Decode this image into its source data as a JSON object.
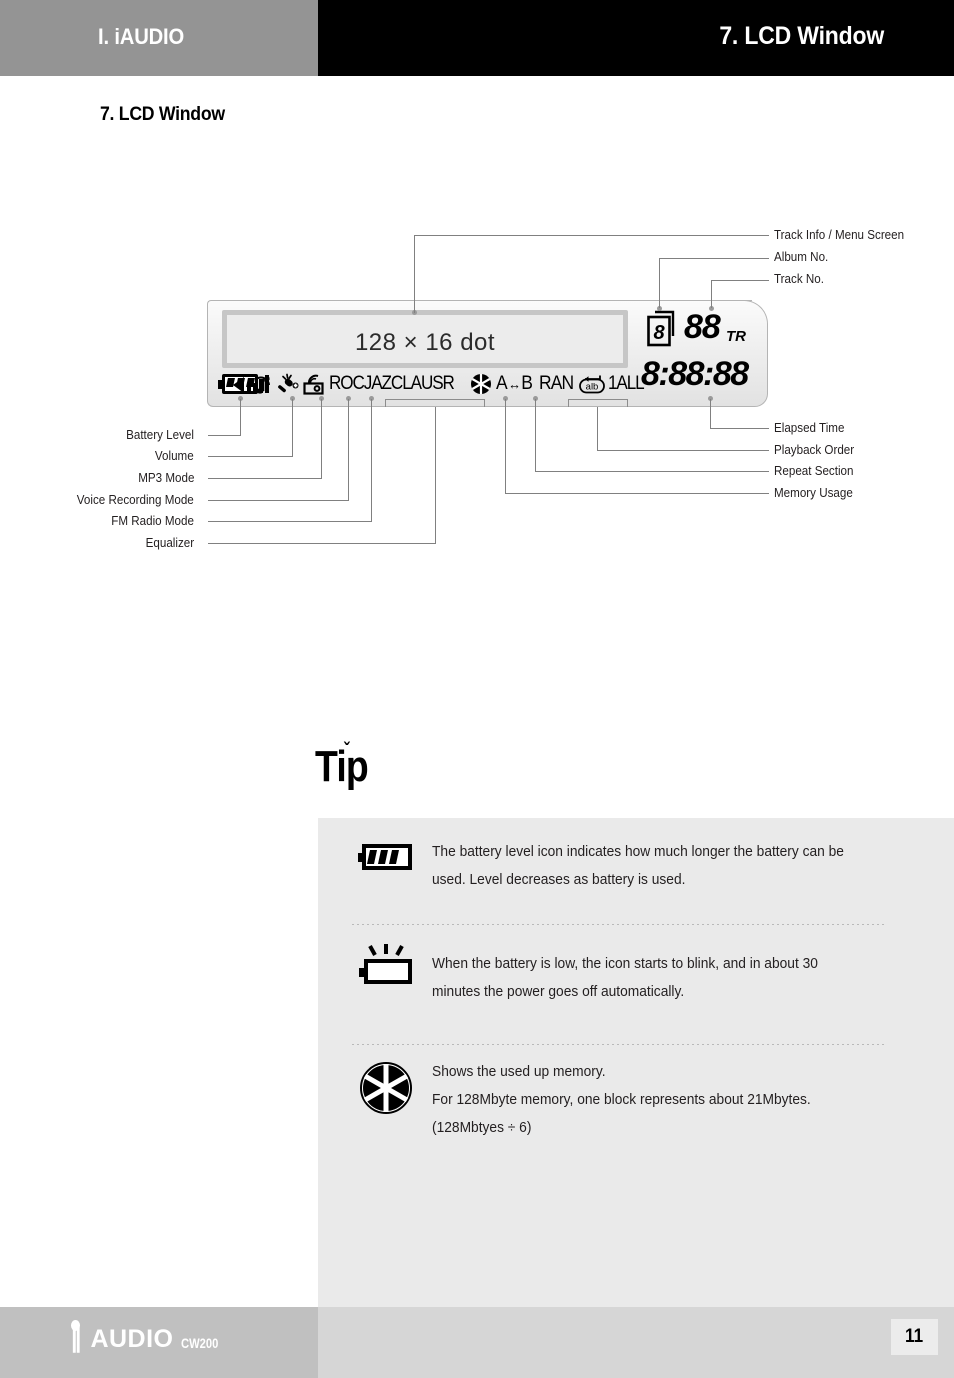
{
  "header": {
    "left_title": "I. iAUDIO",
    "right_title": "7. LCD Window"
  },
  "section": {
    "title": "7. LCD Window"
  },
  "lcd": {
    "screen_text": "128 × 16 dot",
    "equalizer_presets": "ROCJAZCLAUSR",
    "ab_repeat": "A",
    "ab_repeat_b": "B",
    "random": "RAN",
    "album_repeat_label": "alb",
    "one_all": "1ALL",
    "album_digit": "8",
    "track_number": "88",
    "track_unit": "TR",
    "elapsed_time": "8:88:88"
  },
  "callouts_left": [
    {
      "label": "Battery Level"
    },
    {
      "label": "Volume"
    },
    {
      "label": "MP3 Mode"
    },
    {
      "label": "Voice Recording Mode"
    },
    {
      "label": "FM Radio Mode"
    },
    {
      "label": "Equalizer"
    }
  ],
  "callouts_right_top": [
    {
      "label": "Track Info / Menu Screen"
    },
    {
      "label": "Album No."
    },
    {
      "label": "Track No."
    }
  ],
  "callouts_right_bottom": [
    {
      "label": "Elapsed Time"
    },
    {
      "label": "Playback Order"
    },
    {
      "label": "Repeat Section"
    },
    {
      "label": "Memory Usage"
    }
  ],
  "tip": {
    "title": "Tip",
    "items": [
      {
        "icon": "battery-full-icon",
        "lines": [
          "The battery level icon indicates how much longer the battery can be",
          "used. Level decreases as battery is used."
        ]
      },
      {
        "icon": "battery-low-blink-icon",
        "lines": [
          "When the battery is low, the icon starts to blink, and in about 30",
          "minutes the power goes off automatically."
        ]
      },
      {
        "icon": "memory-usage-icon",
        "lines": [
          "Shows the used up memory.",
          "For 128Mbyte memory, one block represents about 21Mbytes.",
          " (128Mbtyes ÷ 6)"
        ]
      }
    ]
  },
  "footer": {
    "brand": "AUDIO",
    "model": "CW200",
    "page": "11"
  },
  "colors": {
    "header_left_bg": "#949494",
    "header_right_bg": "#000000",
    "tip_bg": "#eaeaea",
    "footer_left_bg": "#c0c0c0",
    "footer_right_bg": "#d6d6d6",
    "leader_line": "#808080"
  }
}
